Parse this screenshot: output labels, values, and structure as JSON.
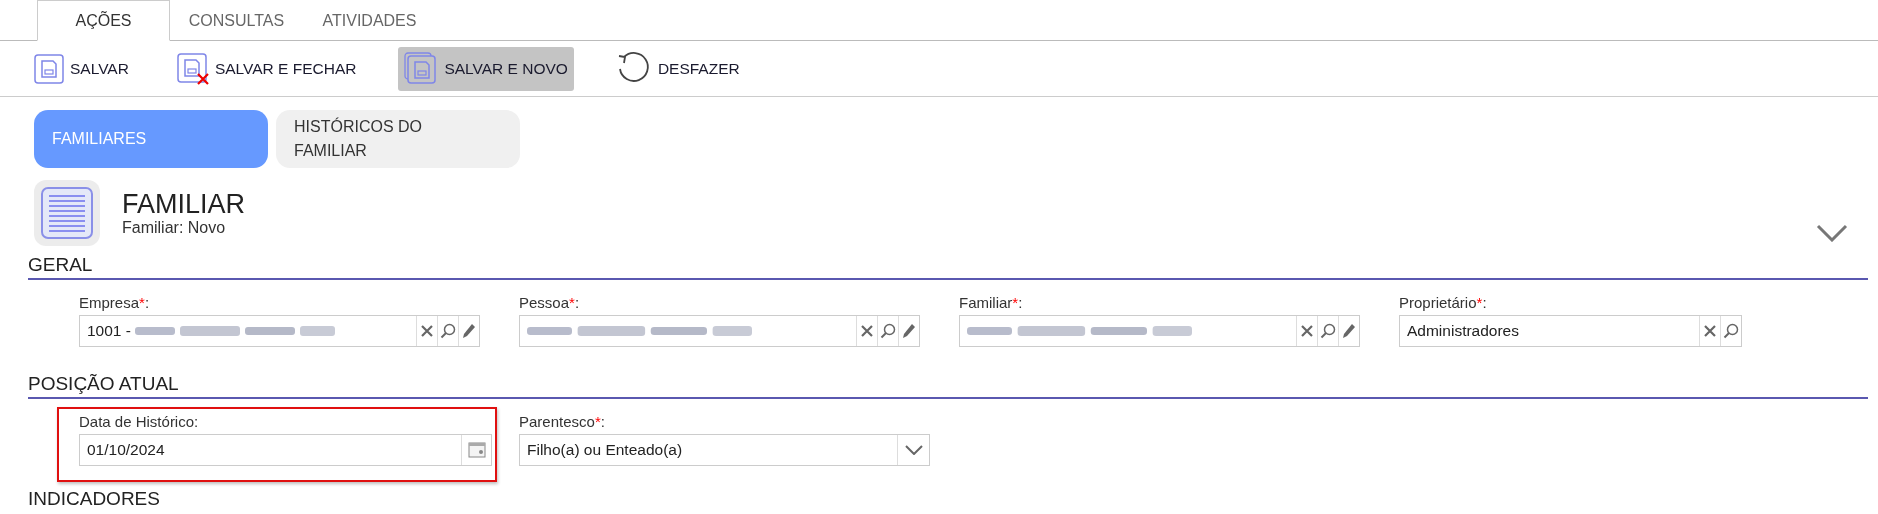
{
  "top_tabs": [
    {
      "label": "AÇÕES",
      "selected": true
    },
    {
      "label": "CONSULTAS",
      "selected": false
    },
    {
      "label": "ATIVIDADES",
      "selected": false
    }
  ],
  "toolbar": [
    {
      "kind": "save",
      "label": "SALVAR",
      "highlighted": false
    },
    {
      "kind": "save_close",
      "label": "SALVAR E FECHAR",
      "highlighted": false
    },
    {
      "kind": "save_new",
      "label": "SALVAR E NOVO",
      "highlighted": true
    },
    {
      "kind": "undo",
      "label": "DESFAZER",
      "highlighted": false
    }
  ],
  "sub_tabs": [
    {
      "label": "FAMILIARES",
      "selected": true
    },
    {
      "label": "HISTÓRICOS DO FAMILIAR",
      "selected": false
    }
  ],
  "header": {
    "title": "FAMILIAR",
    "subtitle": "Familiar: Novo"
  },
  "sections": [
    {
      "title": "GERAL",
      "fields": [
        {
          "kind": "lookup",
          "label": "Empresa",
          "asterisk": "*",
          "colon": ":",
          "value": "1001 - ",
          "redacted": true,
          "edit": true
        },
        {
          "kind": "lookup",
          "label": "Pessoa",
          "asterisk": "*",
          "colon": ":",
          "redacted": true,
          "edit": true
        },
        {
          "kind": "lookup",
          "label": "Familiar",
          "asterisk": "*",
          "colon": ":",
          "redacted": true,
          "edit": true
        },
        {
          "kind": "lookup",
          "label": "Proprietário",
          "asterisk": "*",
          "colon": ":",
          "value": "Administradores",
          "redacted": false,
          "edit": false
        }
      ]
    },
    {
      "title": "POSIÇÃO ATUAL",
      "fields": [
        {
          "kind": "date",
          "label": "Data de Histórico",
          "colon": ":",
          "value": "01/10/2024",
          "outlined": true
        },
        {
          "kind": "select",
          "label": "Parentesco",
          "asterisk": "*",
          "colon": ":",
          "value": "Filho(a) ou Enteado(a)",
          "outlined": false
        }
      ]
    },
    {
      "title": "INDICADORES"
    }
  ]
}
